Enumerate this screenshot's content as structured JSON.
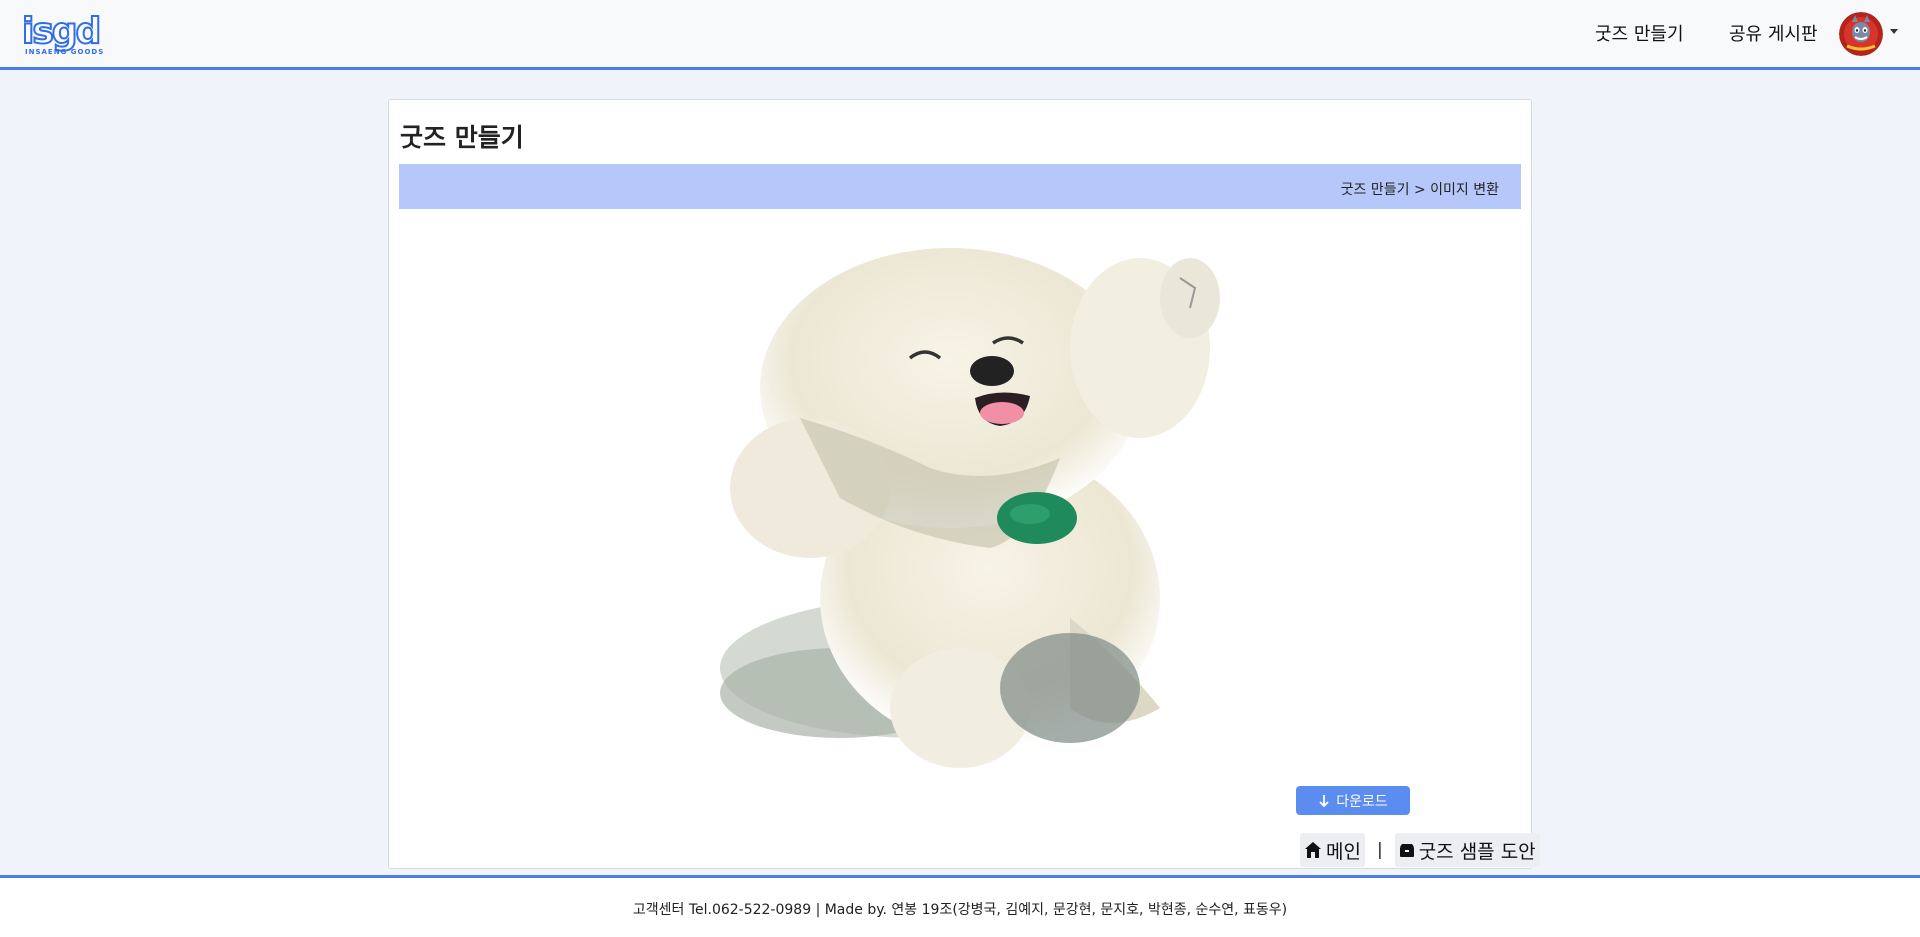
{
  "brand": {
    "logo_text": "isgd",
    "logo_subtext": "INSAENG GOODS",
    "accent_color": "#4a7ee6"
  },
  "nav": {
    "make_goods": "굿즈 만들기",
    "share_board": "공유 게시판",
    "avatar_icon": "user-avatar"
  },
  "page": {
    "title": "굿즈 만들기",
    "breadcrumb": "굿즈 만들기 > 이미지 변환"
  },
  "result": {
    "image_icon": "converted-dog-image",
    "download_label": "다운로드",
    "download_icon": "arrow-down-icon"
  },
  "links": {
    "main_label": "메인",
    "main_icon": "house-icon",
    "separator": "|",
    "sample_label": "굿즈 샘플 도안",
    "sample_icon": "box-icon"
  },
  "footer": {
    "text": "고객센터 Tel.062-522-0989 | Made by. 연봉 19조(강병국, 김예지, 문강현, 문지호, 박현종, 순수연, 표동우)"
  }
}
